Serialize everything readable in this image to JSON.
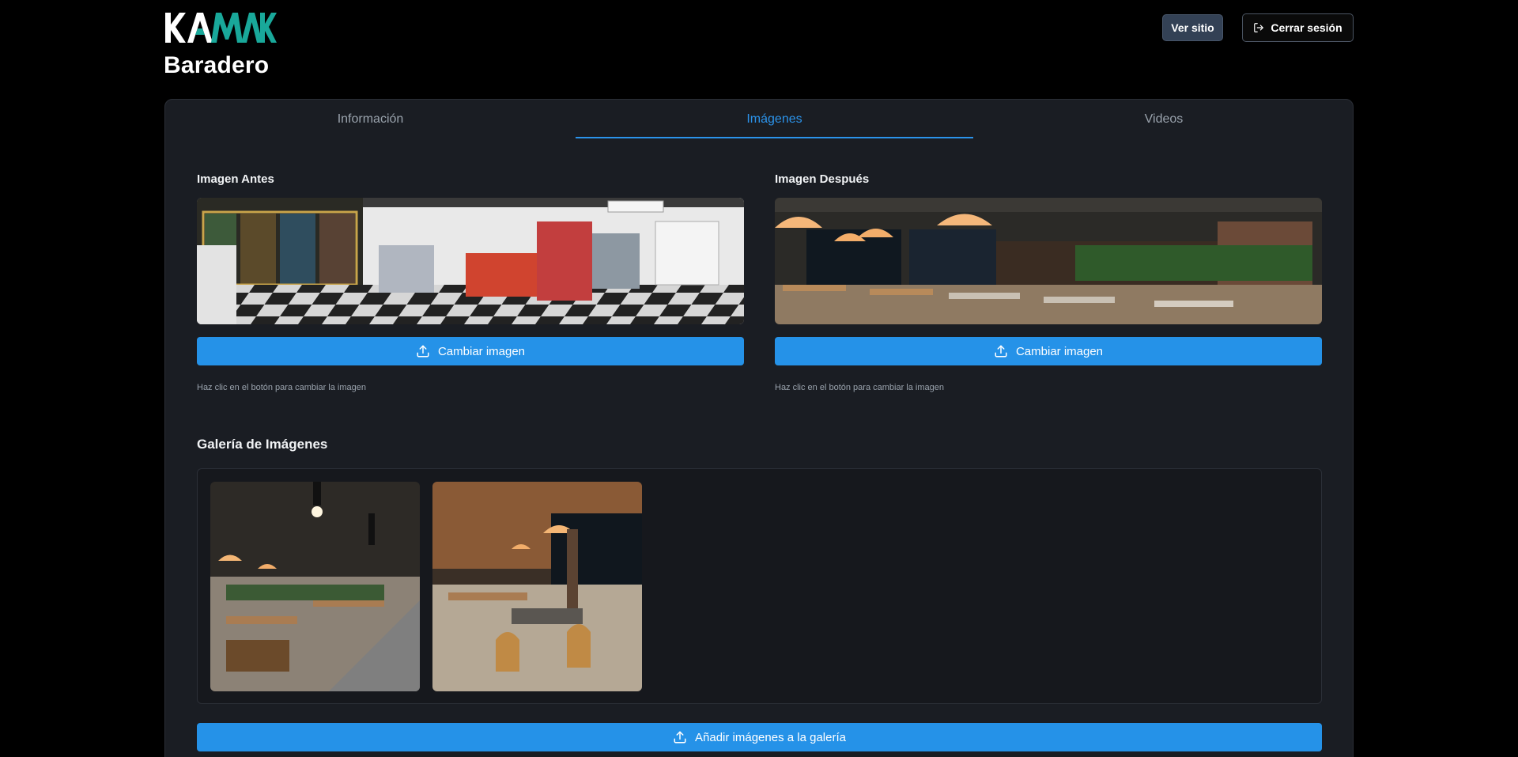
{
  "header": {
    "site_title": "Baradero",
    "ver_sitio_label": "Ver sitio",
    "logout_label": "Cerrar sesión",
    "logo": {
      "text": "KAMAK",
      "color": "#19a89a"
    }
  },
  "tabs": [
    {
      "label": "Información"
    },
    {
      "label": "Imágenes",
      "active": true
    },
    {
      "label": "Videos"
    }
  ],
  "before": {
    "title": "Imagen Antes",
    "button_label": "Cambiar imagen",
    "hint": "Haz clic en el botón para cambiar la imagen"
  },
  "after": {
    "title": "Imagen Después",
    "button_label": "Cambiar imagen",
    "hint": "Haz clic en el botón para cambiar la imagen"
  },
  "gallery": {
    "title": "Galería de Imágenes",
    "add_label": "Añadir imágenes a la galería",
    "image_count": 2
  },
  "colors": {
    "accent": "#2592e8",
    "tab_active": "#2b93ea",
    "card_bg": "#1a1d23",
    "page_bg": "#000000"
  }
}
